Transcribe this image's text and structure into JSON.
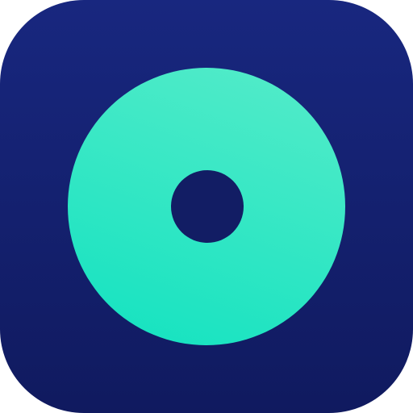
{
  "icon": {
    "name": "disc-icon",
    "colors": {
      "background_top": "#18277f",
      "background_bottom": "#101a5f",
      "disc_top": "#56ecc9",
      "disc_bottom": "#12e2c0",
      "hole": "#121d64"
    }
  }
}
